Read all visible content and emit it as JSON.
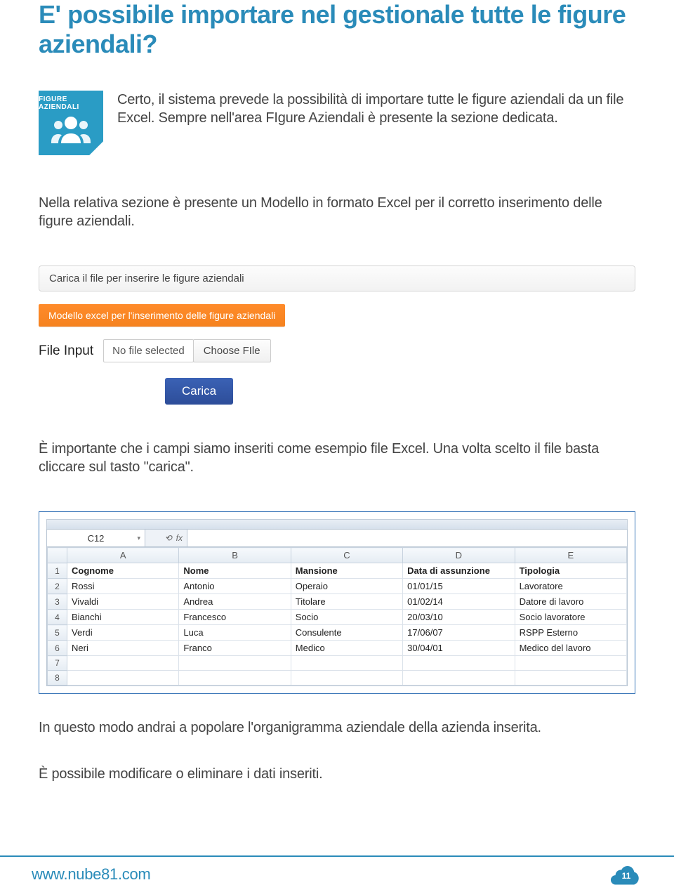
{
  "title": "E' possibile importare nel gestionale tutte le figure aziendali?",
  "tile": {
    "label": "FIGURE AZIENDALI"
  },
  "intro": "Certo, il sistema prevede la possibilità di importare tutte le figure aziendali da un file Excel. Sempre nell'area FIgure Aziendali è presente la sezione dedicata.",
  "para2": "Nella relativa sezione è presente un Modello in formato Excel per il corretto inserimento delle figure aziendali.",
  "upload": {
    "panel_title": "Carica il file per inserire le figure aziendali",
    "orange_btn": "Modello excel per l'inserimento delle figure aziendali",
    "file_label": "File Input",
    "file_display": "No file selected",
    "choose_btn": "Choose FIle",
    "submit_btn": "Carica"
  },
  "para3": "È importante che i campi siamo inseriti come esempio file Excel. Una volta scelto il file basta cliccare sul tasto \"carica\".",
  "excel": {
    "namebox": "C12",
    "fx": "fx",
    "cols": [
      "A",
      "B",
      "C",
      "D",
      "E"
    ],
    "headers": [
      "Cognome",
      "Nome",
      "Mansione",
      "Data di assunzione",
      "Tipologia"
    ],
    "rows": [
      [
        "Rossi",
        "Antonio",
        "Operaio",
        "01/01/15",
        "Lavoratore"
      ],
      [
        "Vivaldi",
        "Andrea",
        "Titolare",
        "01/02/14",
        "Datore di lavoro"
      ],
      [
        "Bianchi",
        "Francesco",
        "Socio",
        "20/03/10",
        "Socio lavoratore"
      ],
      [
        "Verdi",
        "Luca",
        "Consulente",
        "17/06/07",
        "RSPP Esterno"
      ],
      [
        "Neri",
        "Franco",
        "Medico",
        "30/04/01",
        "Medico del lavoro"
      ],
      [
        "",
        "",
        "",
        "",
        ""
      ],
      [
        "",
        "",
        "",
        "",
        ""
      ]
    ]
  },
  "para4": "In questo modo andrai a popolare l'organigramma aziendale della azienda inserita.",
  "para5": "È possibile modificare o eliminare i dati inseriti.",
  "footer": {
    "url": "www.nube81.com",
    "page": "11"
  }
}
